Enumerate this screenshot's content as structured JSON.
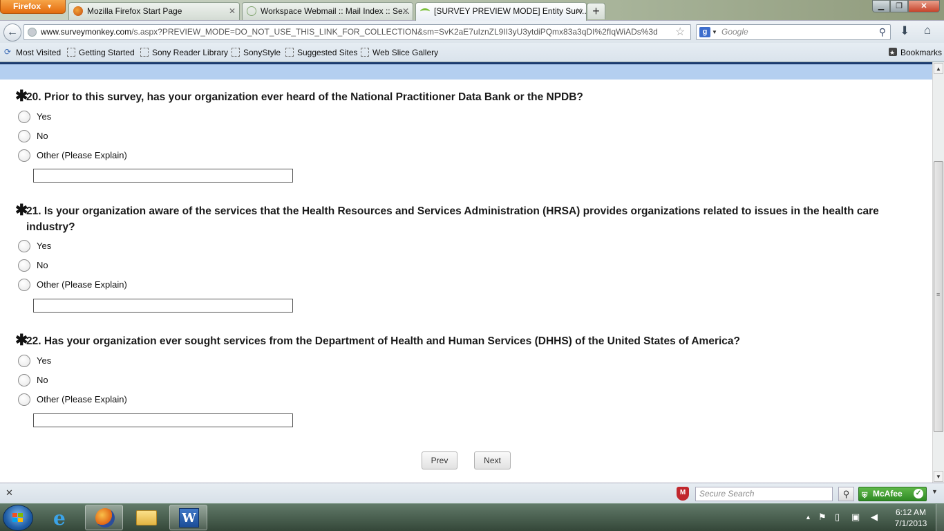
{
  "browser": {
    "menu_label": "Firefox",
    "tabs": [
      {
        "title": "Mozilla Firefox Start Page"
      },
      {
        "title": "Workspace Webmail :: Mail Index :: Se..."
      },
      {
        "title": "[SURVEY PREVIEW MODE] Entity Surv..."
      }
    ],
    "url": {
      "domain": "www.surveymonkey.com",
      "path": "/s.aspx?PREVIEW_MODE=DO_NOT_USE_THIS_LINK_FOR_COLLECTION&sm=SvK2aE7uIznZL9II3yU3ytdiPQmx83a3qDI%2fIqWiADs%3d"
    },
    "search_placeholder": "Google",
    "bookmarks": [
      {
        "label": "Most Visited"
      },
      {
        "label": "Getting Started"
      },
      {
        "label": "Sony Reader Library"
      },
      {
        "label": "SonyStyle"
      },
      {
        "label": "Suggested Sites"
      },
      {
        "label": "Web Slice Gallery"
      },
      {
        "label": "Bookmarks"
      }
    ]
  },
  "survey": {
    "required_marker": "✱",
    "questions": [
      {
        "title": "20. Prior to this survey, has your organization ever heard of the National Practitioner Data Bank or the NPDB?",
        "options": [
          "Yes",
          "No",
          "Other (Please Explain)"
        ]
      },
      {
        "title": "21. Is your organization aware of the services that the Health Resources and Services Administration (HRSA) provides organizations related to issues in the health care industry?",
        "options": [
          "Yes",
          "No",
          "Other (Please Explain)"
        ]
      },
      {
        "title": "22. Has your organization ever sought services from the Department of Health and Human Services (DHHS) of the United States of America?",
        "options": [
          "Yes",
          "No",
          "Other (Please Explain)"
        ]
      }
    ],
    "prev_label": "Prev",
    "next_label": "Next"
  },
  "addon_bar": {
    "secure_search_placeholder": "Secure Search",
    "mcafee_label": "McAfee"
  },
  "taskbar": {
    "time": "6:12 AM",
    "date": "7/1/2013"
  },
  "icons": {
    "back": "back-arrow-icon",
    "star": "bookmark-star-icon",
    "reload": "reload-icon",
    "download": "download-icon",
    "home": "home-icon",
    "search": "search-icon"
  },
  "colors": {
    "firefox_orange": "#e36b0d",
    "survey_band": "#b4cff0",
    "survey_band_border": "#1a3a6e",
    "mcafee_green": "#2f8a24",
    "mcafee_red": "#c1272d"
  }
}
